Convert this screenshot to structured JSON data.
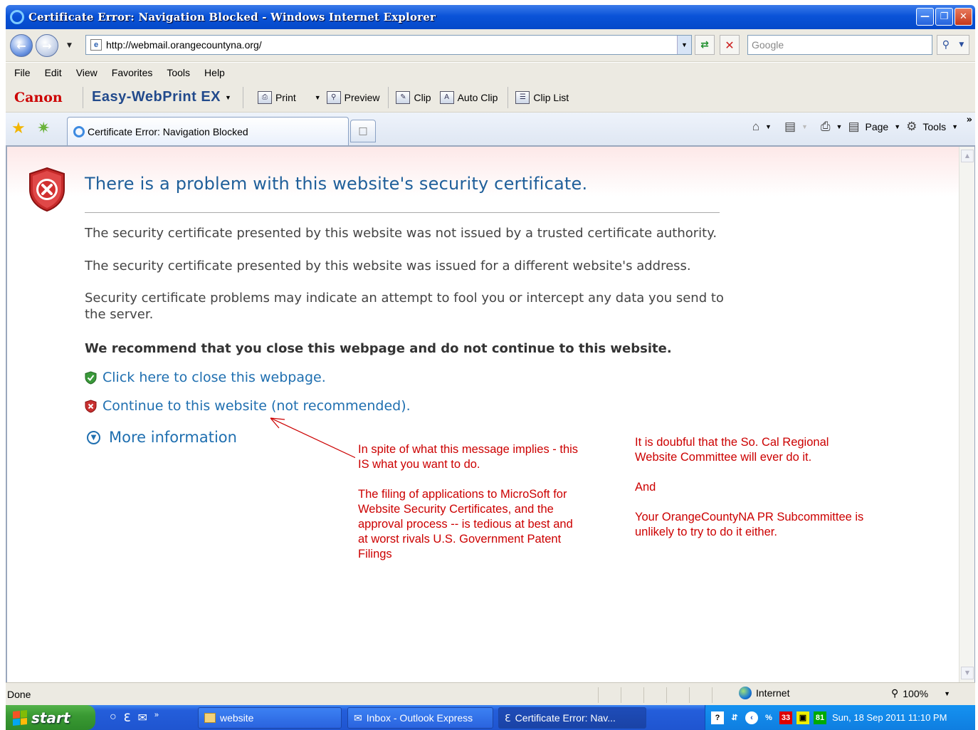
{
  "window": {
    "title": "Certificate Error: Navigation Blocked - Windows Internet Explorer",
    "colors": {
      "titlebar": "#0a53d8",
      "error_red": "#cc0000",
      "link_blue": "#1f6fb0"
    }
  },
  "address_bar": {
    "url": "http://webmail.orangecountyna.org/",
    "search_placeholder": "Google"
  },
  "menu": [
    "File",
    "Edit",
    "View",
    "Favorites",
    "Tools",
    "Help"
  ],
  "canon_toolbar": {
    "brand": "Canon",
    "product": "Easy-WebPrint EX",
    "buttons": [
      "Print",
      "Preview",
      "Clip",
      "Auto Clip",
      "Clip List"
    ]
  },
  "tab": {
    "label": "Certificate Error: Navigation Blocked"
  },
  "command_bar": {
    "page_label": "Page",
    "tools_label": "Tools"
  },
  "content": {
    "heading": "There is a problem with this website's security certificate.",
    "para1": "The security certificate presented by this website was not issued by a trusted certificate authority.",
    "para2": "The security certificate presented by this website was issued for a different website's address.",
    "para3": "Security certificate problems may indicate an attempt to fool you or intercept any data you send to the server.",
    "recommend": "We recommend that you close this webpage and do not continue to this website.",
    "close_link": "Click here to close this webpage.",
    "continue_link": "Continue to this website (not recommended).",
    "more_info": "More information"
  },
  "annotations": {
    "note1": "In spite of what this message implies - this\nIS what you want to do.\n\nThe filing of applications to MicroSoft for\nWebsite Security Certificates, and the\napproval process -- is tedious at best and\nat worst rivals U.S. Government Patent\nFilings",
    "note2": "It is doubful that  the So. Cal Regional\nWebsite Committee will ever do it.\n\nAnd\n\nYour OrangeCountyNA PR Subcommittee is\nunlikely to try to do it either."
  },
  "status_bar": {
    "status": "Done",
    "zone": "Internet",
    "zoom": "100%"
  },
  "taskbar": {
    "start": "start",
    "tasks": [
      "website",
      "Inbox - Outlook Express",
      "Certificate Error: Nav..."
    ],
    "tray_badges": [
      "33",
      "81"
    ],
    "clock": "Sun, 18 Sep 2011   11:10 PM"
  },
  "icons": [
    "ie-logo-icon",
    "back-arrow-icon",
    "forward-arrow-icon",
    "refresh-icon",
    "stop-icon",
    "search-icon",
    "favorites-star-icon",
    "add-favorites-icon",
    "home-icon",
    "rss-feed-icon",
    "printer-icon",
    "page-icon",
    "tools-gear-icon",
    "error-shield-icon",
    "green-shield-icon",
    "red-shield-icon",
    "expand-circle-icon",
    "globe-icon",
    "zoom-icon"
  ]
}
